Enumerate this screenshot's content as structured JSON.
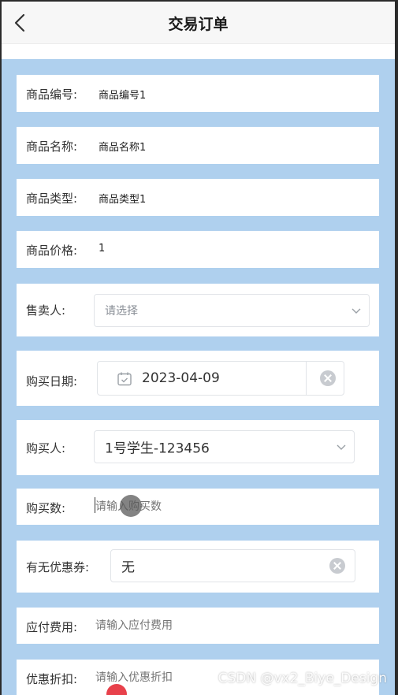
{
  "header": {
    "title": "交易订单"
  },
  "fields": {
    "product_no": {
      "label": "商品编号:",
      "value": "商品编号1"
    },
    "product_name": {
      "label": "商品名称:",
      "value": "商品名称1"
    },
    "product_type": {
      "label": "商品类型:",
      "value": "商品类型1"
    },
    "product_price": {
      "label": "商品价格:",
      "value": "1"
    },
    "seller": {
      "label": "售卖人:",
      "placeholder": "请选择"
    },
    "purchase_date": {
      "label": "购买日期:",
      "value": "2023-04-09"
    },
    "buyer": {
      "label": "购买人:",
      "value": "1号学生-123456"
    },
    "quantity": {
      "label": "购买数:",
      "placeholder": "请输入购买数"
    },
    "coupon": {
      "label": "有无优惠券:",
      "value": "无"
    },
    "payable": {
      "label": "应付费用:",
      "placeholder": "请输入应付费用"
    },
    "discount": {
      "label": "优惠折扣:",
      "placeholder": "请输入优惠折扣"
    }
  },
  "watermark": "CSDN @vx2_Biye_Design",
  "colors": {
    "background": "#afd0ee",
    "header": "#f7f7f7"
  }
}
